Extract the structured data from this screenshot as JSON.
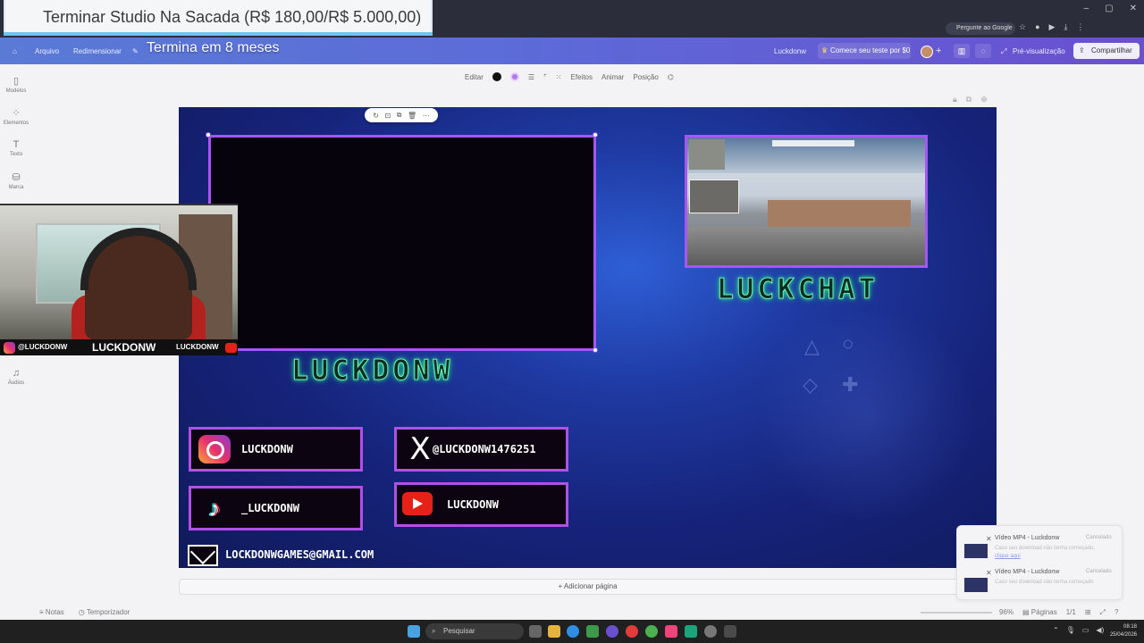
{
  "goal": {
    "title": "Terminar Studio Na Sacada (R$ 180,00/R$ 5.000,00)",
    "subtitle": "Termina em 8 meses"
  },
  "browser": {
    "google_button": "Pergunte ao Google"
  },
  "menubar": {
    "file": "Arquivo",
    "resize": "Redimensionar",
    "project_name": "Luckdonw",
    "trial": "Comece seu teste por $0",
    "preview": "Pré-visualização",
    "share": "Compartilhar"
  },
  "rail": [
    {
      "icon": "layout-icon",
      "label": "Modelos"
    },
    {
      "icon": "elements-icon",
      "label": "Elementos"
    },
    {
      "icon": "text-icon",
      "label": "Texto"
    },
    {
      "icon": "brand-icon",
      "label": "Marca"
    },
    {
      "icon": "audio-icon",
      "label": "Áudios"
    }
  ],
  "toolbar": {
    "edit": "Editar",
    "effects": "Efeitos",
    "animate": "Animar",
    "position": "Posição"
  },
  "design": {
    "chat_title": "LUCKCHAT",
    "streamer_name": "LUCKDONW",
    "socials": [
      {
        "network": "instagram",
        "handle": "LUCKDONW"
      },
      {
        "network": "x",
        "handle": "@LUCKDONW1476251"
      },
      {
        "network": "tiktok",
        "handle": "_LUCKDONW"
      },
      {
        "network": "youtube",
        "handle": "LUCKDONW"
      }
    ],
    "email": "LOCKDONWGAMES@GMAIL.COM"
  },
  "webcam": {
    "ig_handle": "@LUCKDONW",
    "name": "LUCKDONW",
    "yt_handle": "LUCKDONW"
  },
  "bottom": {
    "add_page": "+ Adicionar página",
    "notes": "Notas",
    "timer": "Temporizador",
    "zoom": "96%",
    "pages_label": "Páginas",
    "pages_count": "1/1"
  },
  "downloads": [
    {
      "title": "Vídeo MP4 - Luckdonw",
      "status": "Cancelado",
      "desc": "Caso seu download não tenha começado,",
      "link": "clique aqui"
    },
    {
      "title": "Vídeo MP4 - Luckdonw",
      "status": "Cancelado",
      "desc": "Caso seu download não tenha começado",
      "link": ""
    }
  ],
  "taskbar": {
    "search": "Pesquisar",
    "time": "08:18",
    "date": "25/04/2026"
  },
  "colors": {
    "frame_purple": "#a855f7",
    "neon_green": "#6ff0b0",
    "menubar_start": "#5a7ad6",
    "menubar_end": "#6a4fcf"
  }
}
